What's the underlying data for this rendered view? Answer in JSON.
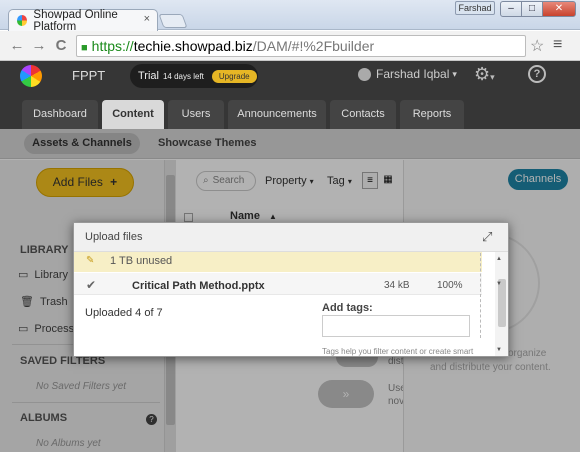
{
  "browser": {
    "tab_title": "Showpad Online Platform",
    "tab_close": "×",
    "user_badge": "Farshad",
    "win_min": "–",
    "win_max": "□",
    "win_close": "✕",
    "back": "←",
    "forward": "→",
    "reload": "C",
    "url_scheme": "https://",
    "url_domain": "techie.showpad.biz",
    "url_path": "/DAM/#!%2Fbuilder",
    "star": "☆",
    "menu": "≡"
  },
  "header": {
    "brand": "FPPT",
    "trial_label": "Trial",
    "trial_days": "14 days left",
    "upgrade": "Upgrade",
    "account_name": "Farshad Iqbal",
    "account_caret": "▾",
    "gear": "⚙",
    "gear_caret": "▾",
    "help": "?"
  },
  "tabs": [
    "Dashboard",
    "Content",
    "Users",
    "Announcements",
    "Contacts",
    "Reports"
  ],
  "subnav": {
    "active": "Assets & Channels",
    "other": "Showcase Themes"
  },
  "sidebar": {
    "add_files": "Add Files",
    "add_icon": "+",
    "library_header": "LIBRARY",
    "items": [
      "Library",
      "Trash",
      "Process"
    ],
    "saved_filters_header": "SAVED FILTERS",
    "saved_filters_empty": "No Saved Filters yet",
    "albums_header": "ALBUMS",
    "albums_help": "?",
    "albums_empty": "No Albums yet"
  },
  "content": {
    "search_placeholder": "Search",
    "property": "Property",
    "tag": "Tag",
    "caret": "▾",
    "col_name": "Name",
    "sort_icon": "▲",
    "channels": "Channels",
    "organize_1": "organize",
    "organize_2": "and distribute your content.",
    "distri": "distri",
    "use_1": "Use",
    "use_2": "novi"
  },
  "modal": {
    "title": "Upload files",
    "storage": "1 TB unused",
    "file_name": "Critical Path Method.pptx",
    "file_size": "34 kB",
    "file_progress": "100%",
    "status": "Uploaded 4 of 7",
    "add_tags_label": "Add tags:",
    "tags_help": "Tags help you filter content or create smart",
    "expand": "⤢",
    "check": "✔"
  }
}
